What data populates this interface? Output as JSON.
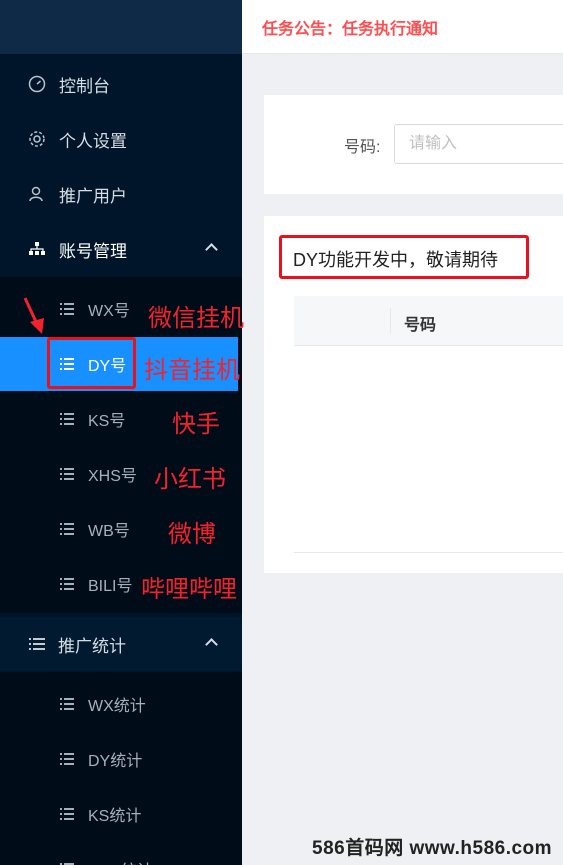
{
  "header": {
    "notice": "任务公告：任务执行通知"
  },
  "sidebar": {
    "items": [
      {
        "label": "控制台",
        "icon": "dashboard-icon"
      },
      {
        "label": "个人设置",
        "icon": "gear-icon"
      },
      {
        "label": "推广用户",
        "icon": "user-icon"
      },
      {
        "label": "账号管理",
        "icon": "sitemap-icon"
      }
    ],
    "account_sub": [
      "WX号",
      "DY号",
      "KS号",
      "XHS号",
      "WB号",
      "BILI号"
    ],
    "stats_group": "推广统计",
    "stats_sub": [
      "WX统计",
      "DY统计",
      "KS统计",
      "XHS统计"
    ]
  },
  "search": {
    "label": "号码:",
    "placeholder": "请输入"
  },
  "table": {
    "message": "DY功能开发中，敬请期待",
    "columns": [
      "号码"
    ]
  },
  "annotations": [
    "微信挂机",
    "抖音挂机",
    "快手",
    "小红书",
    "微博",
    "哔哩哔哩"
  ],
  "watermark": "586首码网 www.h586.com",
  "colors": {
    "sidebar_bg": "#001529",
    "active": "#1890ff",
    "notice": "#ff4d4f",
    "annotation": "#f5222d"
  }
}
